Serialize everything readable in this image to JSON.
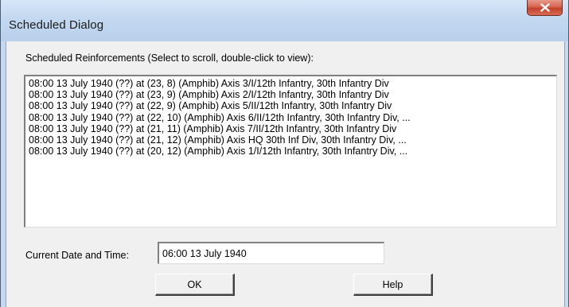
{
  "window": {
    "title": "Scheduled Dialog"
  },
  "icons": {
    "close": "close-icon"
  },
  "colors": {
    "titlebar": "#c3d8f0",
    "close_button": "#c2412a",
    "dialog_face": "#f0f0f0"
  },
  "reinforcements": {
    "label": "Scheduled Reinforcements (Select to scroll, double-click to view):",
    "items": [
      "08:00 13 July 1940 (??) at (23, 8) (Amphib) Axis 3/I/12th Infantry, 30th Infantry Div",
      "08:00 13 July 1940 (??) at (23, 9) (Amphib) Axis 2/I/12th Infantry, 30th Infantry Div",
      "08:00 13 July 1940 (??) at (22, 9) (Amphib) Axis 5/II/12th Infantry, 30th Infantry Div",
      "08:00 13 July 1940 (??) at (22, 10) (Amphib) Axis 6/II/12th Infantry, 30th Infantry Div, ...",
      "08:00 13 July 1940 (??) at (21, 11) (Amphib) Axis 7/II/12th Infantry, 30th Infantry Div",
      "08:00 13 July 1940 (??) at (21, 12) (Amphib) Axis HQ 30th Inf Div, 30th Infantry Div, ...",
      "08:00 13 July 1940 (??) at (20, 12) (Amphib) Axis 1/I/12th Infantry, 30th Infantry Div, ..."
    ]
  },
  "current": {
    "label": "Current Date and Time:",
    "value": "06:00 13 July 1940"
  },
  "buttons": {
    "ok": "OK",
    "help": "Help"
  }
}
